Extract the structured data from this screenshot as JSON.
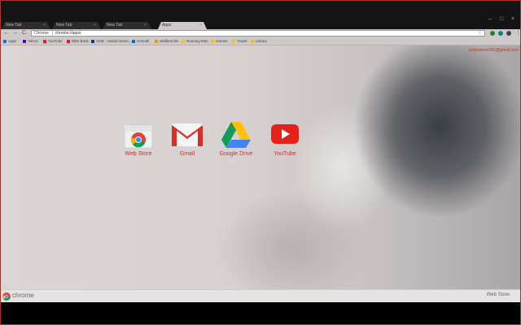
{
  "tabs": [
    {
      "title": "New Tab",
      "close": "×",
      "active": false
    },
    {
      "title": "New Tab",
      "close": "×",
      "active": false
    },
    {
      "title": "New Tab",
      "close": "×",
      "active": false
    },
    {
      "title": "Apps",
      "close": "×",
      "active": true
    }
  ],
  "window_controls": {
    "minimize": "–",
    "maximize": "□",
    "close": "×"
  },
  "toolbar": {
    "back": "←",
    "forward": "→",
    "reload": "C",
    "omnibox_chip": "Chrome",
    "url": "chrome://apps",
    "star": "☆",
    "menu": "⋮"
  },
  "bookmarks": [
    {
      "label": "Apps",
      "color": "#1a73e8"
    },
    {
      "label": "Yahoo",
      "color": "#6001d2"
    },
    {
      "label": "YouTube",
      "color": "#e62117"
    },
    {
      "label": "DBS Bank",
      "color": "#e21a22"
    },
    {
      "label": "UOB : United Overs...",
      "color": "#0b3b8c"
    },
    {
      "label": "Hotmail",
      "color": "#0072c6"
    },
    {
      "label": "Welfareclini",
      "color": "#e59a00"
    },
    {
      "label": "Running Man",
      "color": "#f4c20d"
    },
    {
      "label": "Games",
      "color": "#f4c20d"
    },
    {
      "label": "Travel",
      "color": "#f4c20d"
    },
    {
      "label": "Library",
      "color": "#f4c20d"
    }
  ],
  "user_email": "andywinner001@gmail.com",
  "apps": [
    {
      "label": "Web Store",
      "icon": "webstore-icon"
    },
    {
      "label": "Gmail",
      "icon": "gmail-icon"
    },
    {
      "label": "Google Drive",
      "icon": "drive-icon"
    },
    {
      "label": "YouTube",
      "icon": "youtube-icon"
    }
  ],
  "bottom_bar": {
    "brand": "chrome",
    "webstore_link": "Web Store"
  },
  "colors": {
    "accent": "#d0312d",
    "frame": "#cfc9c9",
    "tabstrip": "#141414"
  }
}
